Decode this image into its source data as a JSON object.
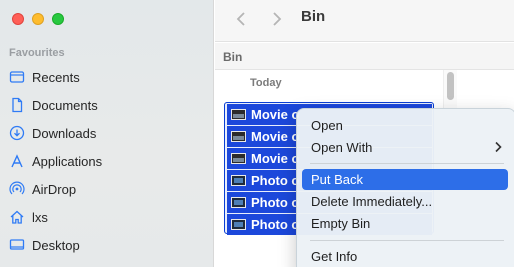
{
  "sidebar": {
    "heading": "Favourites",
    "items": [
      {
        "label": "Recents",
        "icon": "recents-icon"
      },
      {
        "label": "Documents",
        "icon": "document-icon"
      },
      {
        "label": "Downloads",
        "icon": "downloads-icon"
      },
      {
        "label": "Applications",
        "icon": "applications-icon"
      },
      {
        "label": "AirDrop",
        "icon": "airdrop-icon"
      },
      {
        "label": "lxs",
        "icon": "home-icon"
      },
      {
        "label": "Desktop",
        "icon": "desktop-icon"
      }
    ]
  },
  "toolbar": {
    "title": "Bin"
  },
  "content": {
    "path_label": "Bin",
    "group_header": "Today",
    "files": [
      {
        "name": "Movie o",
        "kind": "movie"
      },
      {
        "name": "Movie o",
        "kind": "movie"
      },
      {
        "name": "Movie o",
        "kind": "movie"
      },
      {
        "name": "Photo o",
        "kind": "photo"
      },
      {
        "name": "Photo o",
        "kind": "photo"
      },
      {
        "name": "Photo o",
        "kind": "photo"
      }
    ]
  },
  "context_menu": {
    "items": [
      {
        "label": "Open"
      },
      {
        "label": "Open With",
        "submenu": true
      },
      {
        "label": "Put Back",
        "highlighted": true
      },
      {
        "label": "Delete Immediately..."
      },
      {
        "label": "Empty Bin"
      },
      {
        "label": "Get Info"
      }
    ]
  },
  "colors": {
    "accent": "#2d6ee8",
    "selection": "#1c48db",
    "sidebar_icon": "#2f7bf5"
  }
}
